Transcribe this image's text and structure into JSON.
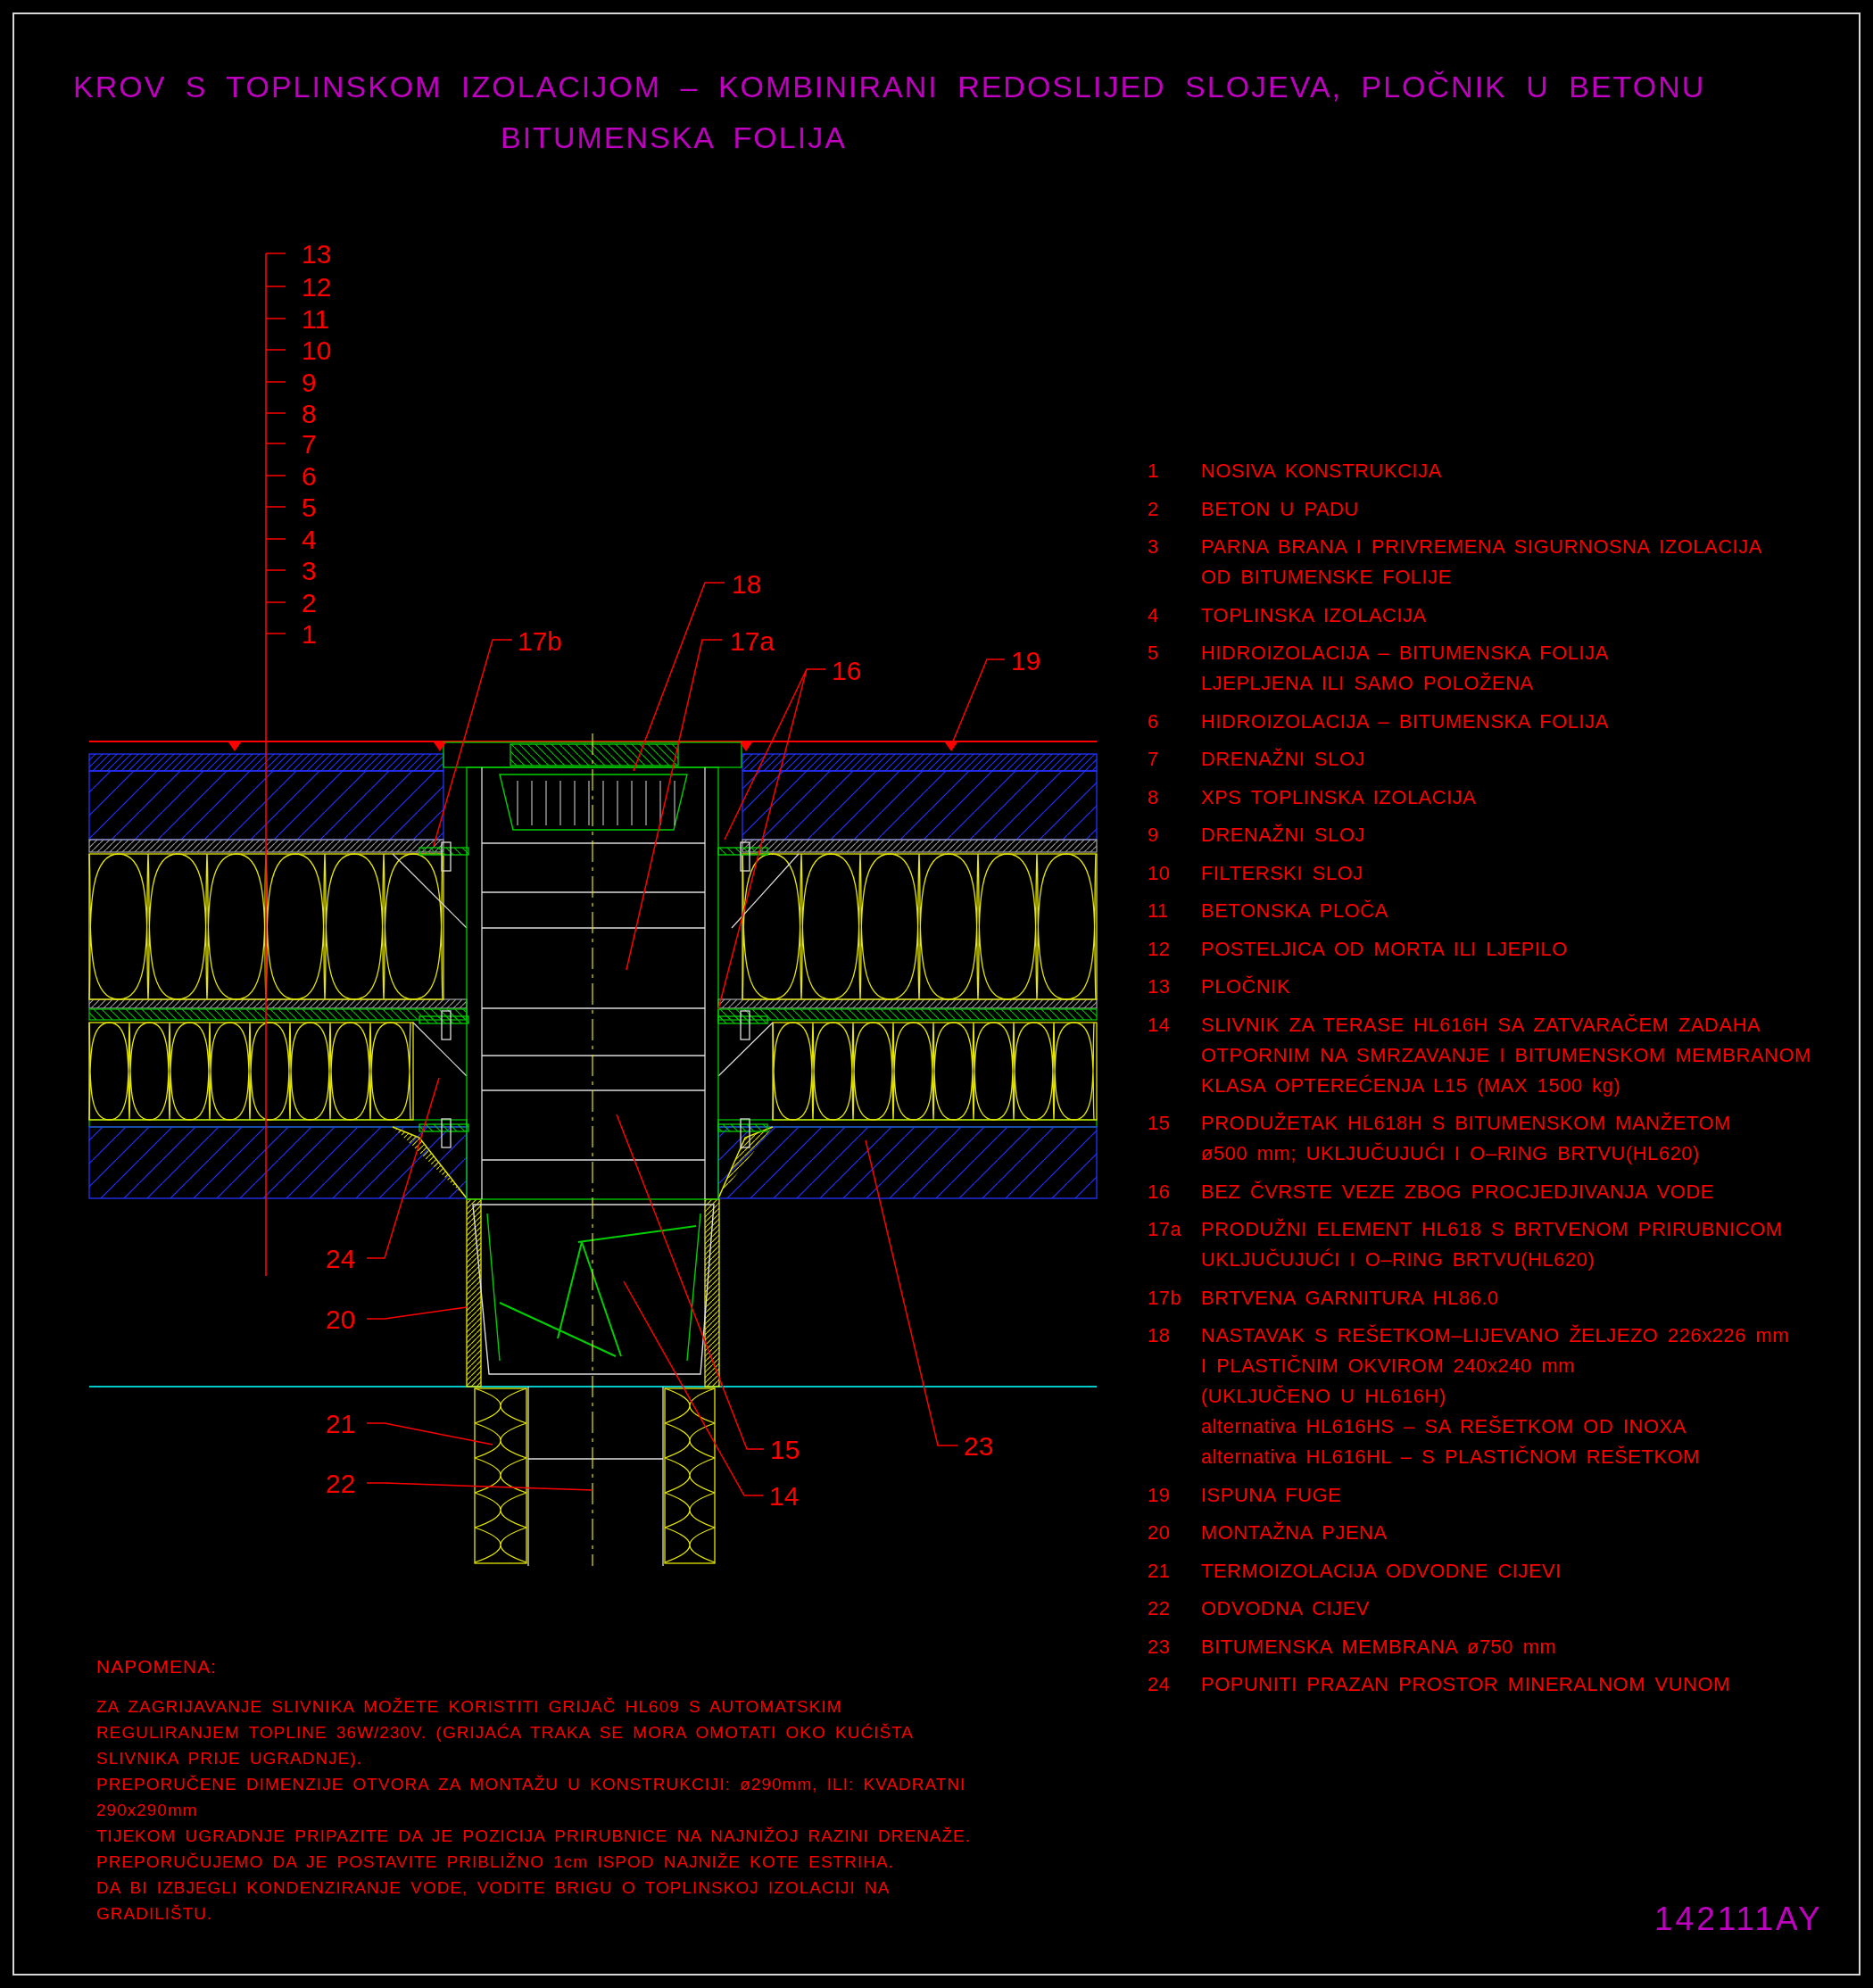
{
  "title": {
    "lines": [
      "KROV S TOPLINSKOM IZOLACIJOM – KOMBINIRANI REDOSLIJED SLOJEVA, PLOČNIK U BETONU",
      "BITUMENSKA FOLIJA"
    ]
  },
  "drawing": {
    "layer_scale": [
      "13",
      "12",
      "11",
      "10",
      "9",
      "8",
      "7",
      "6",
      "5",
      "4",
      "3",
      "2",
      "1"
    ],
    "callouts": [
      "18",
      "17b",
      "17a",
      "16",
      "19",
      "24",
      "20",
      "21",
      "22",
      "15",
      "14",
      "23"
    ]
  },
  "legend": [
    {
      "number": "1",
      "lines": [
        "NOSIVA KONSTRUKCIJA"
      ]
    },
    {
      "number": "2",
      "lines": [
        "BETON U PADU"
      ]
    },
    {
      "number": "3",
      "lines": [
        "PARNA BRANA I PRIVREMENA SIGURNOSNA IZOLACIJA",
        "OD BITUMENSKE FOLIJE"
      ]
    },
    {
      "number": "4",
      "lines": [
        "TOPLINSKA IZOLACIJA"
      ]
    },
    {
      "number": "5",
      "lines": [
        "HIDROIZOLACIJA – BITUMENSKA FOLIJA",
        "LJEPLJENA ILI SAMO POLOŽENA"
      ]
    },
    {
      "number": "6",
      "lines": [
        "HIDROIZOLACIJA – BITUMENSKA FOLIJA"
      ]
    },
    {
      "number": "7",
      "lines": [
        "DRENAŽNI SLOJ"
      ]
    },
    {
      "number": "8",
      "lines": [
        "XPS TOPLINSKA IZOLACIJA"
      ]
    },
    {
      "number": "9",
      "lines": [
        "DRENAŽNI SLOJ"
      ]
    },
    {
      "number": "10",
      "lines": [
        "FILTERSKI SLOJ"
      ]
    },
    {
      "number": "11",
      "lines": [
        "BETONSKA PLOČA"
      ]
    },
    {
      "number": "12",
      "lines": [
        "POSTELJICA OD MORTA ILI LJEPILO"
      ]
    },
    {
      "number": "13",
      "lines": [
        "PLOČNIK"
      ]
    },
    {
      "number": "14",
      "lines": [
        "SLIVNIK ZA TERASE HL616H SA ZATVARAČEM ZADAHA",
        "OTPORNIM NA SMRZAVANJE I BITUMENSKOM MEMBRANOM",
        "KLASA OPTEREĆENJA L15 (MAX 1500 kg)"
      ]
    },
    {
      "number": "15",
      "lines": [
        "PRODUŽETAK HL618H S BITUMENSKOM MANŽETOM",
        "ø500 mm; UKLJUČUJUĆI I O–RING BRTVU(HL620)"
      ]
    },
    {
      "number": "16",
      "lines": [
        "BEZ ČVRSTE VEZE ZBOG PROCJEDJIVANJA VODE"
      ]
    },
    {
      "number": "17a",
      "lines": [
        "PRODUŽNI ELEMENT HL618 S BRTVENOM PRIRUBNICOM",
        "UKLJUČUJUĆI I O–RING BRTVU(HL620)"
      ]
    },
    {
      "number": "17b",
      "lines": [
        "BRTVENA GARNITURA HL86.0"
      ]
    },
    {
      "number": "18",
      "lines": [
        "NASTAVAK S REŠETKOM–LIJEVANO ŽELJEZO 226x226 mm",
        "I PLASTIČNIM OKVIROM 240x240 mm",
        "(UKLJUČENO U  HL616H)",
        "alternativa HL616HS – SA REŠETKOM OD INOXA",
        "alternativa HL616HL – S PLASTIČNOM REŠETKOM"
      ]
    },
    {
      "number": "19",
      "lines": [
        "ISPUNA FUGE"
      ]
    },
    {
      "number": "20",
      "lines": [
        "MONTAŽNA PJENA"
      ]
    },
    {
      "number": "21",
      "lines": [
        "TERMOIZOLACIJA ODVODNE CIJEVI"
      ]
    },
    {
      "number": "22",
      "lines": [
        "ODVODNA CIJEV"
      ]
    },
    {
      "number": "23",
      "lines": [
        "BITUMENSKA MEMBRANA ø750 mm"
      ]
    },
    {
      "number": "24",
      "lines": [
        "POPUNITI PRAZAN PROSTOR MINERALNOM VUNOM"
      ]
    }
  ],
  "notes": {
    "heading": "NAPOMENA:",
    "lines": [
      "ZA ZAGRIJAVANJE SLIVNIKA MOŽETE KORISTITI GRIJAČ HL609 S AUTOMATSKIM",
      "REGULIRANJEM TOPLINE 36W/230V. (GRIJAĆA TRAKA SE MORA OMOTATI OKO KUĆIŠTA",
      "SLIVNIKA PRIJE UGRADNJE).",
      "PREPORUČENE DIMENZIJE OTVORA ZA MONTAŽU U KONSTRUKCIJI: ø290mm, ILI: KVADRATNI",
      "290x290mm",
      "TIJEKOM UGRADNJE PRIPAZITE DA JE POZICIJA PRIRUBNICE NA NAJNIŽOJ RAZINI DRENAŽE.",
      "PREPORUČUJEMO DA JE POSTAVITE PRIBLIŽNO 1cm ISPOD NAJNIŽE KOTE ESTRIHA.",
      "DA BI IZBJEGLI KONDENZIRANJE VODE, VODITE BRIGU O TOPLINSKOJ IZOLACIJI NA",
      "GRADILIŠTU."
    ]
  },
  "drawing_code": "142111AY"
}
